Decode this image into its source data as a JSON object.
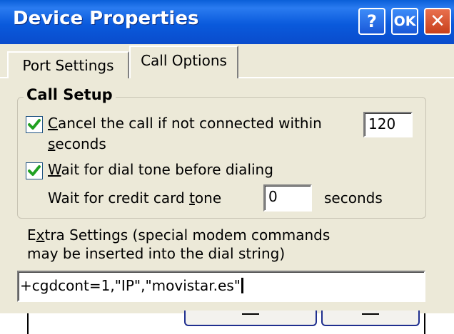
{
  "window": {
    "title": "Device Properties"
  },
  "titlebar": {
    "help_label": "?",
    "ok_label": "OK",
    "close_label": "✕"
  },
  "tabs": [
    {
      "label": "Port Settings",
      "selected": false
    },
    {
      "label": "Call Options",
      "selected": true
    }
  ],
  "call_setup": {
    "group_label": "Call Setup",
    "cancel_call": {
      "checked": true,
      "label_prefix": "C",
      "label_rest": "ancel the call if not connected within",
      "value": "120",
      "unit_prefix": "s",
      "unit_rest": "econds"
    },
    "wait_dial_tone": {
      "checked": true,
      "label_prefix": "W",
      "label_rest": "ait for dial tone before dialing"
    },
    "credit_card": {
      "label_pre": "Wait for credit card ",
      "label_ul": "t",
      "label_post": "one",
      "value": "0",
      "unit": "seconds"
    }
  },
  "extra_settings": {
    "label_line1_pre": "E",
    "label_line1_ul": "x",
    "label_line1_post": "tra Settings (special modem commands",
    "label_line2": "may be inserted into the dial string)",
    "value": "+cgdcont=1,\"IP\",\"movistar.es\""
  },
  "colors": {
    "titlebar": "#0a5adc",
    "dialog_bg": "#ece9d8",
    "check_green": "#21a121"
  }
}
